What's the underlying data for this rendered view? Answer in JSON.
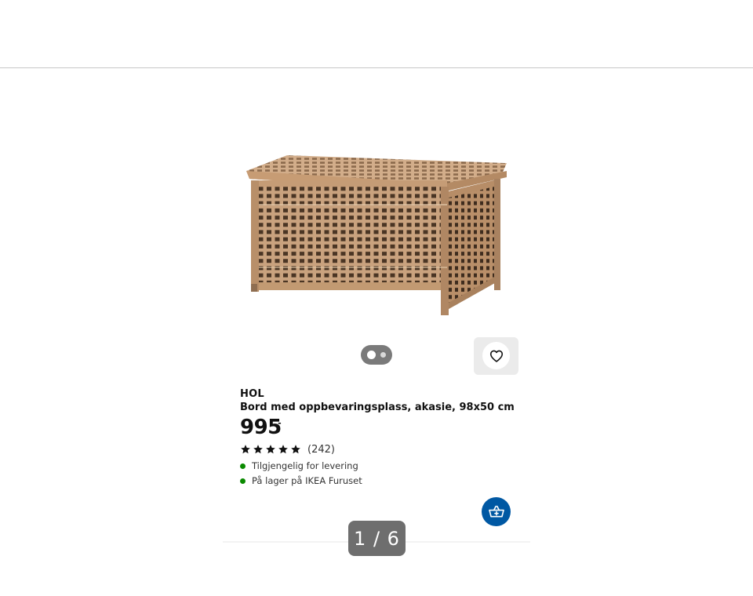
{
  "product": {
    "name": "HOL",
    "description": "Bord med oppbevaringsplass, akasie, 98x50 cm",
    "price": "995",
    "price_suffix": ",-",
    "rating": {
      "stars": 5,
      "review_count": "(242)"
    },
    "availability": [
      {
        "text": "Tilgjengelig for levering",
        "color": "#0a8a00"
      },
      {
        "text": "På lager på IKEA Furuset",
        "color": "#0a8a00"
      }
    ],
    "media_count": 2,
    "active_media": 1
  },
  "pager": {
    "label": "1 / 6"
  },
  "icons": {
    "favorite": "heart-icon",
    "add_to_cart": "cart-add-icon",
    "star": "star-icon"
  },
  "colors": {
    "accent": "#0058a3",
    "in_stock": "#0a8a00",
    "pager_bg": "#6e6e6e"
  }
}
